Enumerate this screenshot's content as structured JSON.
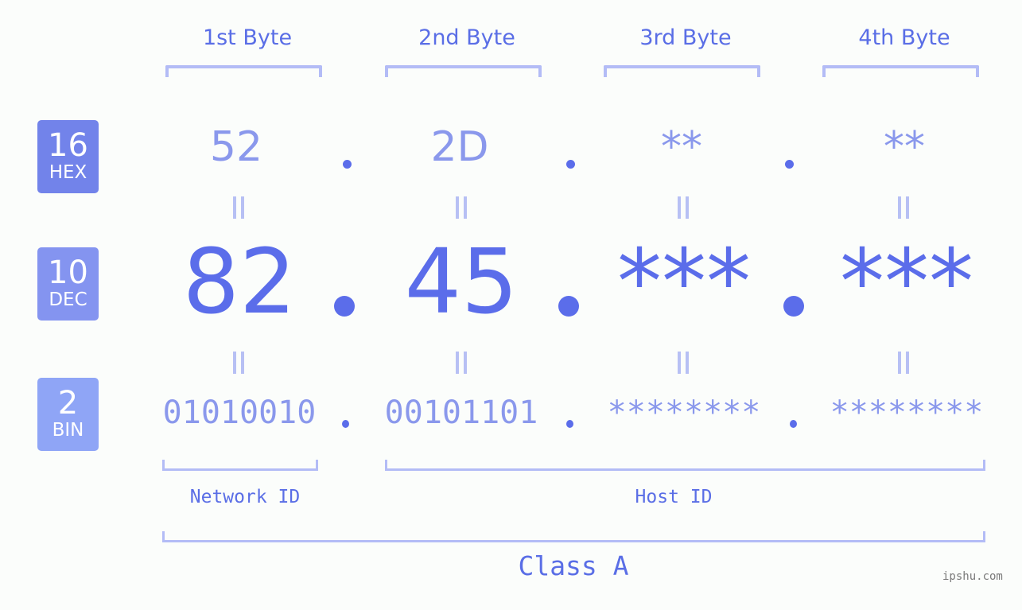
{
  "bytes": [
    {
      "header": "1st Byte",
      "hex": "52",
      "dec": "82",
      "bin": "01010010"
    },
    {
      "header": "2nd Byte",
      "hex": "2D",
      "dec": "45",
      "bin": "00101101"
    },
    {
      "header": "3rd Byte",
      "hex": "**",
      "dec": "***",
      "bin": "********"
    },
    {
      "header": "4th Byte",
      "hex": "**",
      "dec": "***",
      "bin": "********"
    }
  ],
  "badges": {
    "hex": {
      "num": "16",
      "label": "HEX",
      "color": "#7283ea"
    },
    "dec": {
      "num": "10",
      "label": "DEC",
      "color": "#8494f0"
    },
    "bin": {
      "num": "2",
      "label": "BIN",
      "color": "#8fa5f6"
    }
  },
  "segments": {
    "network": "Network ID",
    "host": "Host ID",
    "class": "Class A"
  },
  "watermark": "ipshu.com"
}
